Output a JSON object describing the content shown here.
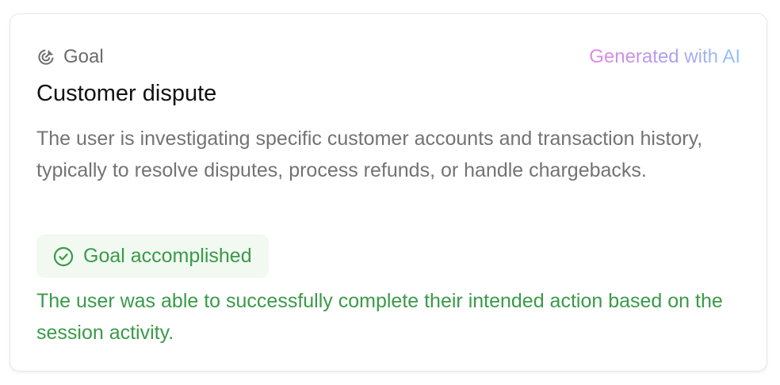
{
  "card": {
    "section_label": "Goal",
    "section_icon": "goal-target-icon",
    "ai_badge": "Generated with AI",
    "title": "Customer dispute",
    "description": "The user is investigating specific customer accounts and transaction history, typically to resolve disputes, process refunds, or handle chargebacks.",
    "status": {
      "icon": "check-circle-icon",
      "label": "Goal accomplished",
      "description": "The user was able to successfully complete their intended action based on the session activity."
    }
  },
  "colors": {
    "status_green": "#3a9a48",
    "status_bg": "#f1f9f1",
    "muted_text": "#737373",
    "ai_gradient_start": "#e488e0",
    "ai_gradient_end": "#8ec6f5"
  }
}
